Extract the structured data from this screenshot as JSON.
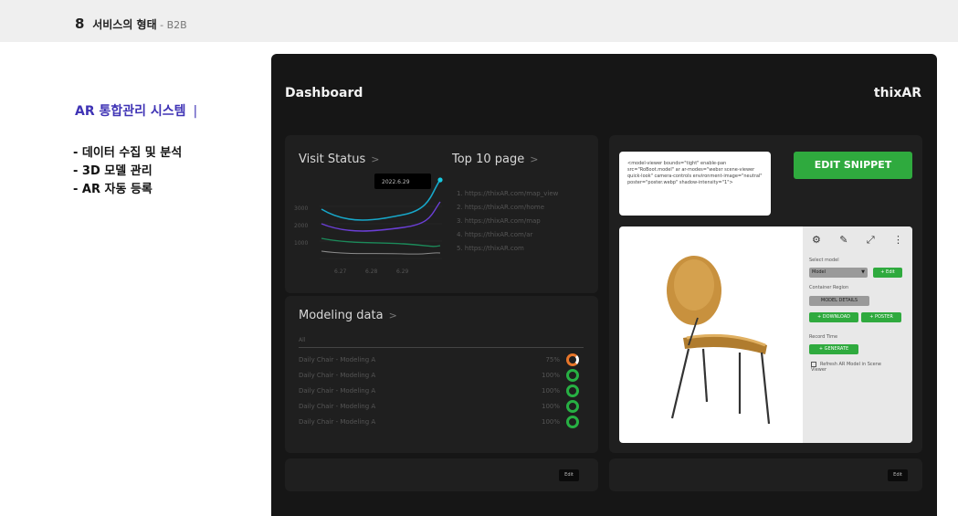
{
  "header": {
    "number": "8",
    "title": "서비스의 형태",
    "separator": " - ",
    "subtitle": "B2B"
  },
  "left": {
    "title": "AR 통합관리 시스템",
    "title_bar": "|",
    "features": [
      "- 데이터 수집 및 분석",
      "- 3D 모델 관리",
      "- AR 자동 등록"
    ]
  },
  "dashboard": {
    "title": "Dashboard",
    "brand": "thixAR",
    "visit_status": {
      "label": "Visit Status",
      "chevron": ">",
      "tooltip": "2022.6.29",
      "y_ticks": [
        "3000",
        "2000",
        "1000"
      ],
      "x_ticks": [
        "6.27",
        "6.28",
        "6.29"
      ]
    },
    "top_pages": {
      "label": "Top 10 page",
      "chevron": ">",
      "items": [
        "1. https://thixAR.com/map_view",
        "2. https://thixAR.com/home",
        "3. https://thixAR.com/map",
        "4. https://thixAR.com/ar",
        "5. https://thixAR.com"
      ]
    },
    "modeling": {
      "label": "Modeling data",
      "chevron": ">",
      "header": "All",
      "rows": [
        {
          "name": "Daily Chair - Modeling A",
          "pct": "75%",
          "state": "partial"
        },
        {
          "name": "Daily Chair - Modeling A",
          "pct": "100%",
          "state": "done"
        },
        {
          "name": "Daily Chair - Modeling A",
          "pct": "100%",
          "state": "done"
        },
        {
          "name": "Daily Chair - Modeling A",
          "pct": "100%",
          "state": "done"
        },
        {
          "name": "Daily Chair - Modeling A",
          "pct": "100%",
          "state": "done"
        }
      ]
    },
    "bottom_left_button": "Edit",
    "bottom_right_button": "Edit",
    "snippet": {
      "code": "<model-viewer bounds=\"tight\" enable-pan src=\"RoBoot.model\" ar ar-modes=\"webxr scene-viewer quick-look\" camera-controls environment-image=\"neutral\" poster=\"poster.webp\" shadow-intensity=\"1\">",
      "edit_label": "EDIT SNIPPET"
    },
    "viewer": {
      "tool_icons": [
        "⚙",
        "✎",
        "⤢",
        "⋮"
      ],
      "select_model_label": "Select model",
      "select_value": "Model",
      "select_arrow": "▼",
      "edit_label": "+ Edit",
      "container_label": "Container Region",
      "model_details": "MODEL DETAILS",
      "download": "+ DOWNLOAD",
      "poster": "+ POSTER",
      "record_label": "Record Time",
      "generate": "+ GENERATE",
      "checkbox_label": "Refresh AR Model in Scene Viewer"
    }
  }
}
